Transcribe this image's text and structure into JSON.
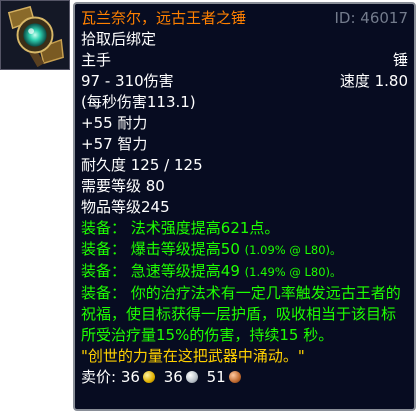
{
  "item": {
    "icon": "hammer-icon",
    "name": "瓦兰奈尔，远古王者之锤",
    "id_label": "ID: 46017",
    "binding": "拾取后绑定",
    "slot": "主手",
    "type": "锤",
    "damage": "97 - 310伤害",
    "speed": "速度 1.80",
    "dps": "(每秒伤害113.1)",
    "stats": [
      "+55 耐力",
      "+57 智力"
    ],
    "durability": "耐久度 125 / 125",
    "required_level": "需要等级 80",
    "item_level": "物品等级245",
    "equip": [
      {
        "label": "装备：",
        "text": "法术强度提高621点。",
        "note": ""
      },
      {
        "label": "装备：",
        "text": "爆击等级提高50",
        "note": "(1.09% @ L80)。"
      },
      {
        "label": "装备：",
        "text": "急速等级提高49",
        "note": "(1.49% @ L80)。"
      }
    ],
    "proc": "装备： 你的治疗法术有一定几率触发远古王者的祝福，使目标获得一层护盾，吸收相当于该目标所受治疗量15%的伤害，持续15 秒。",
    "flavor": "\"创世的力量在这把武器中涌动。\"",
    "sell_label": "卖价:",
    "sell": {
      "gold": "36",
      "silver": "36",
      "copper": "51"
    }
  },
  "colors": {
    "legendary": "#ff8000",
    "equip": "#1eff00",
    "flavor": "#ffd100",
    "background": "#070c21",
    "id": "#737b8c"
  }
}
